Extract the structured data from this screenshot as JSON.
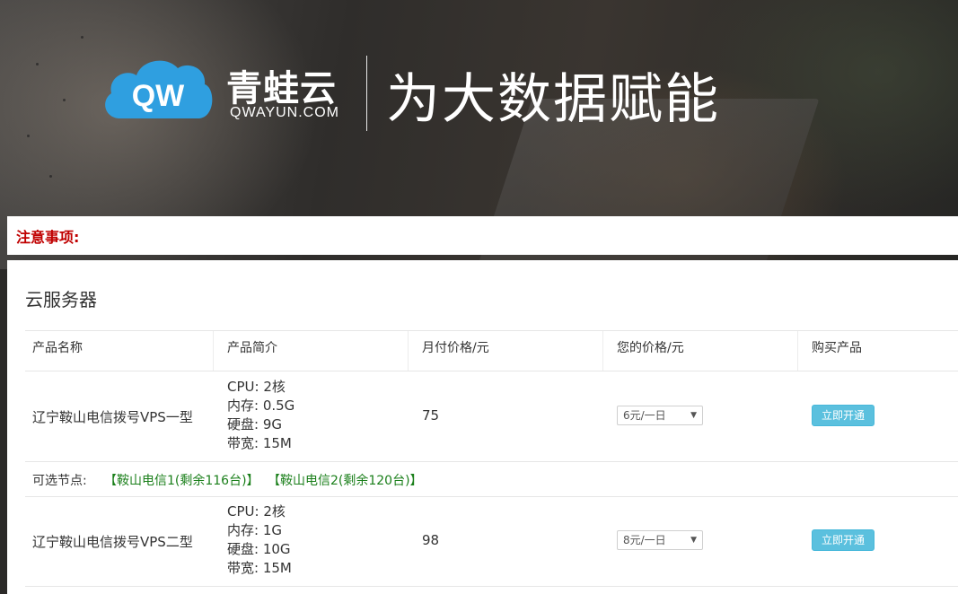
{
  "brand": {
    "logo_text": "QW",
    "name_cn": "青蛙云",
    "domain": "QWAYUN.COM",
    "slogan": "为大数据赋能",
    "logo_color": "#2f9fe0"
  },
  "notice": {
    "label": "注意事项:"
  },
  "section": {
    "title": "云服务器"
  },
  "table": {
    "headers": [
      "产品名称",
      "产品简介",
      "月付价格/元",
      "您的价格/元",
      "购买产品"
    ],
    "rows": [
      {
        "name": "辽宁鞍山电信拨号VPS一型",
        "cpu": "CPU:  2核",
        "mem": "内存:  0.5G",
        "disk": "硬盘:  9G",
        "bw": "带宽:  15M",
        "price": "75",
        "select_value": "6元/一日",
        "buy": "立即开通",
        "nodes_label": "可选节点:",
        "nodes": [
          "【鞍山电信1(剩余116台)】",
          "【鞍山电信2(剩余120台)】"
        ]
      },
      {
        "name": "辽宁鞍山电信拨号VPS二型",
        "cpu": "CPU:  2核",
        "mem": "内存:  1G",
        "disk": "硬盘:  10G",
        "bw": "带宽:  15M",
        "price": "98",
        "select_value": "8元/一日",
        "buy": "立即开通"
      }
    ]
  },
  "colors": {
    "notice_red": "#c00000",
    "node_green": "#1a7f1a",
    "button_blue": "#5bc0de"
  }
}
